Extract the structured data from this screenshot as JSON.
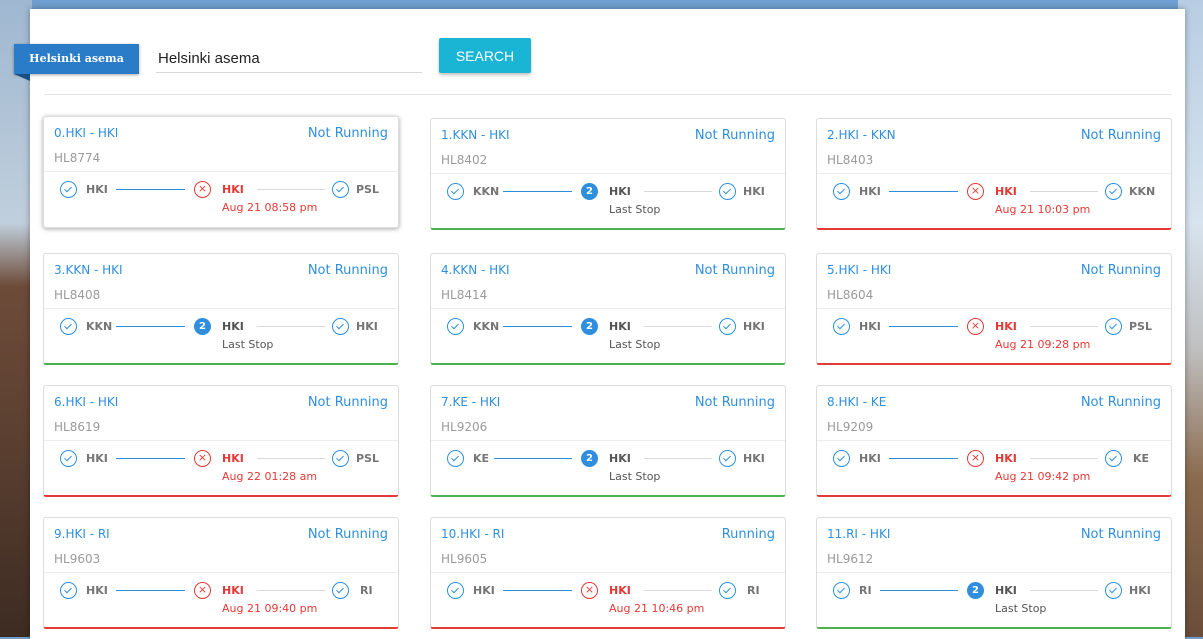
{
  "search": {
    "tag_label": "Helsinki asema",
    "input_value": "Helsinki asema",
    "button_label": "SEARCH"
  },
  "trains": [
    {
      "title": "0.HKI - HKI",
      "status": "Not Running",
      "train_id": "HL8774",
      "from": "HKI",
      "mid": "HKI",
      "to": "PSL",
      "mid_marker": "cross",
      "mid_number": "",
      "sub": "Aug 21 08:58 pm"
    },
    {
      "title": "1.KKN - HKI",
      "status": "Not Running",
      "train_id": "HL8402",
      "from": "KKN",
      "mid": "HKI",
      "to": "HKI",
      "mid_marker": "number",
      "mid_number": "2",
      "sub": "Last Stop"
    },
    {
      "title": "2.HKI - KKN",
      "status": "Not Running",
      "train_id": "HL8403",
      "from": "HKI",
      "mid": "HKI",
      "to": "KKN",
      "mid_marker": "cross",
      "mid_number": "",
      "sub": "Aug 21 10:03 pm"
    },
    {
      "title": "3.KKN - HKI",
      "status": "Not Running",
      "train_id": "HL8408",
      "from": "KKN",
      "mid": "HKI",
      "to": "HKI",
      "mid_marker": "number",
      "mid_number": "2",
      "sub": "Last Stop"
    },
    {
      "title": "4.KKN - HKI",
      "status": "Not Running",
      "train_id": "HL8414",
      "from": "KKN",
      "mid": "HKI",
      "to": "HKI",
      "mid_marker": "number",
      "mid_number": "2",
      "sub": "Last Stop"
    },
    {
      "title": "5.HKI - HKI",
      "status": "Not Running",
      "train_id": "HL8604",
      "from": "HKI",
      "mid": "HKI",
      "to": "PSL",
      "mid_marker": "cross",
      "mid_number": "",
      "sub": "Aug 21 09:28 pm"
    },
    {
      "title": "6.HKI - HKI",
      "status": "Not Running",
      "train_id": "HL8619",
      "from": "HKI",
      "mid": "HKI",
      "to": "PSL",
      "mid_marker": "cross",
      "mid_number": "",
      "sub": "Aug 22 01:28 am"
    },
    {
      "title": "7.KE - HKI",
      "status": "Not Running",
      "train_id": "HL9206",
      "from": "KE",
      "mid": "HKI",
      "to": "HKI",
      "mid_marker": "number",
      "mid_number": "2",
      "sub": "Last Stop"
    },
    {
      "title": "8.HKI - KE",
      "status": "Not Running",
      "train_id": "HL9209",
      "from": "HKI",
      "mid": "HKI",
      "to": "KE",
      "mid_marker": "cross",
      "mid_number": "",
      "sub": "Aug 21 09:42 pm"
    },
    {
      "title": "9.HKI - RI",
      "status": "Not Running",
      "train_id": "HL9603",
      "from": "HKI",
      "mid": "HKI",
      "to": "RI",
      "mid_marker": "cross",
      "mid_number": "",
      "sub": "Aug 21 09:40 pm"
    },
    {
      "title": "10.HKI - RI",
      "status": "Running",
      "train_id": "HL9605",
      "from": "HKI",
      "mid": "HKI",
      "to": "RI",
      "mid_marker": "cross",
      "mid_number": "",
      "sub": "Aug 21 10:46 pm"
    },
    {
      "title": "11.RI - HKI",
      "status": "Not Running",
      "train_id": "HL9612",
      "from": "RI",
      "mid": "HKI",
      "to": "HKI",
      "mid_marker": "number",
      "mid_number": "2",
      "sub": "Last Stop"
    }
  ],
  "colors": {
    "accent": "#2f8fde",
    "button": "#1ab5d4",
    "ok": "#4caf50",
    "late": "#e53935"
  }
}
